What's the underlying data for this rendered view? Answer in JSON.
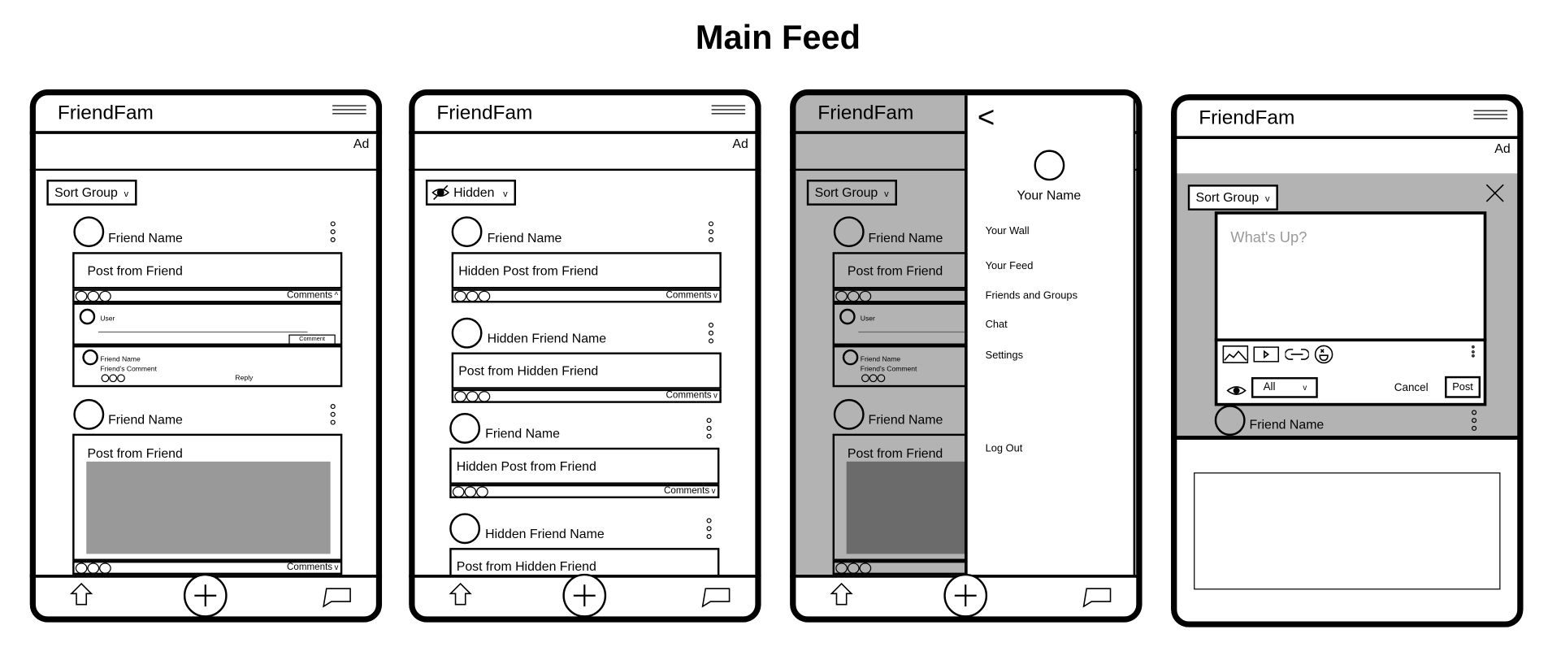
{
  "page_title": "Main Feed",
  "colors": {
    "ink": "#000000",
    "overlay_dim": "#b3b3b3",
    "image_placeholder": "#999999",
    "image_dimmed": "#6b6b6b",
    "placeholder_text": "#999999"
  },
  "screen1": {
    "app_name": "FriendFam",
    "ad": "Ad",
    "menu_icon": "hamburger-icon",
    "sort": {
      "label": "Sort Group",
      "chevron": "v"
    },
    "posts": [
      {
        "friend_name": "Friend Name",
        "text": "Post from Friend",
        "comments_label": "Comments",
        "comments_toggle": "^",
        "comment_input": {
          "user": "User",
          "button": "Comment"
        },
        "comment": {
          "friend_name": "Friend Name",
          "text": "Friend's Comment",
          "reply": "Reply"
        }
      },
      {
        "friend_name": "Friend Name",
        "text": "Post from Friend",
        "has_image": true,
        "comments_label": "Comments",
        "comments_toggle": "v"
      }
    ],
    "nav": [
      "home-icon",
      "add-icon",
      "chat-icon"
    ]
  },
  "screen2": {
    "app_name": "FriendFam",
    "ad": "Ad",
    "filter": {
      "label": "Hidden",
      "chevron": "v",
      "icon": "eye-slash-icon"
    },
    "posts": [
      {
        "friend_name": "Friend Name",
        "text": "Hidden Post from Friend",
        "comments_label": "Comments",
        "comments_toggle": "v"
      },
      {
        "friend_name": "Hidden Friend Name",
        "text": "Post from Hidden Friend",
        "comments_label": "Comments",
        "comments_toggle": "v"
      },
      {
        "friend_name": "Friend Name",
        "text": "Hidden Post from Friend",
        "comments_label": "Comments",
        "comments_toggle": "v"
      },
      {
        "friend_name": "Hidden Friend Name",
        "text": "Post from Hidden Friend"
      }
    ]
  },
  "screen3": {
    "app_name": "FriendFam",
    "sort": {
      "label": "Sort Group",
      "chevron": "v"
    },
    "posts": [
      {
        "friend_name": "Friend Name",
        "text": "Post from Friend",
        "comment_input": {
          "user": "User"
        },
        "comment": {
          "friend_name": "Friend Name",
          "text": "Friend's Comment"
        }
      },
      {
        "friend_name": "Friend Name",
        "text": "Post from Friend",
        "has_image": true
      }
    ],
    "drawer": {
      "back": "<",
      "user_name": "Your Name",
      "menu": [
        "Your Wall",
        "Your Feed",
        "Friends and Groups",
        "Chat",
        "Settings"
      ],
      "logout": "Log Out"
    }
  },
  "screen4": {
    "app_name": "FriendFam",
    "ad": "Ad",
    "sort": {
      "label": "Sort Group",
      "chevron": "v"
    },
    "compose": {
      "placeholder": "What's Up?",
      "tools": [
        "image-icon",
        "video-icon",
        "link-icon",
        "emoji-icon"
      ],
      "audience": "All",
      "audience_chevron": "v",
      "cancel": "Cancel",
      "post": "Post"
    },
    "posts": [
      {
        "friend_name": "Friend Name"
      }
    ]
  }
}
